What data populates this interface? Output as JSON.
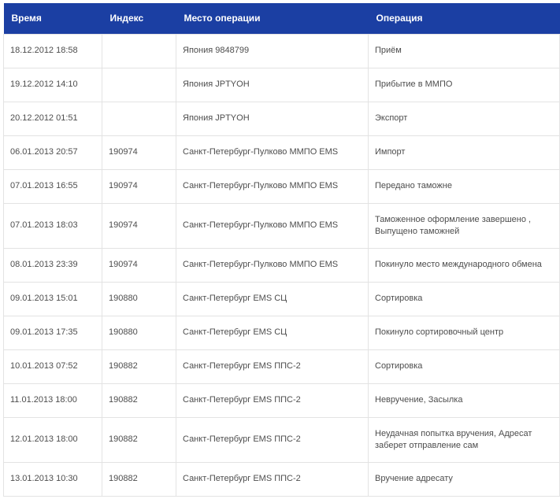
{
  "table": {
    "columns": [
      "Время",
      "Индекс",
      "Место операции",
      "Операция"
    ],
    "rows": [
      {
        "time": "18.12.2012 18:58",
        "index": "",
        "place": "Япония 9848799",
        "operation": "Приём",
        "tall": false
      },
      {
        "time": "19.12.2012 14:10",
        "index": "",
        "place": "Япония JPTYOH",
        "operation": "Прибытие в ММПО",
        "tall": false
      },
      {
        "time": "20.12.2012 01:51",
        "index": "",
        "place": "Япония JPTYOH",
        "operation": "Экспорт",
        "tall": false
      },
      {
        "time": "06.01.2013 20:57",
        "index": "190974",
        "place": "Санкт-Петербург-Пулково ММПО EMS",
        "operation": "Импорт",
        "tall": false
      },
      {
        "time": "07.01.2013 16:55",
        "index": "190974",
        "place": "Санкт-Петербург-Пулково ММПО EMS",
        "operation": "Передано таможне",
        "tall": false
      },
      {
        "time": "07.01.2013 18:03",
        "index": "190974",
        "place": "Санкт-Петербург-Пулково ММПО EMS",
        "operation": "Таможенное оформление завершено , Выпущено таможней",
        "tall": true
      },
      {
        "time": "08.01.2013 23:39",
        "index": "190974",
        "place": "Санкт-Петербург-Пулково ММПО EMS",
        "operation": "Покинуло место международного обмена",
        "tall": false
      },
      {
        "time": "09.01.2013 15:01",
        "index": "190880",
        "place": "Санкт-Петербург EMS СЦ",
        "operation": "Сортировка",
        "tall": false
      },
      {
        "time": "09.01.2013 17:35",
        "index": "190880",
        "place": "Санкт-Петербург EMS СЦ",
        "operation": "Покинуло сортировочный центр",
        "tall": false
      },
      {
        "time": "10.01.2013 07:52",
        "index": "190882",
        "place": "Санкт-Петербург EMS ППС-2",
        "operation": "Сортировка",
        "tall": false
      },
      {
        "time": "11.01.2013 18:00",
        "index": "190882",
        "place": "Санкт-Петербург EMS ППС-2",
        "operation": "Невручение, Засылка",
        "tall": false
      },
      {
        "time": "12.01.2013 18:00",
        "index": "190882",
        "place": "Санкт-Петербург EMS ППС-2",
        "operation": "Неудачная попытка вручения, Адресат заберет отправление сам",
        "tall": true
      },
      {
        "time": "13.01.2013 10:30",
        "index": "190882",
        "place": "Санкт-Петербург EMS ППС-2",
        "operation": "Вручение адресату",
        "tall": false
      }
    ]
  },
  "colors": {
    "header_bg": "#1b3fa3",
    "header_text": "#ffffff",
    "cell_border": "#e3e3e3",
    "cell_text": "#4d4d4d"
  }
}
